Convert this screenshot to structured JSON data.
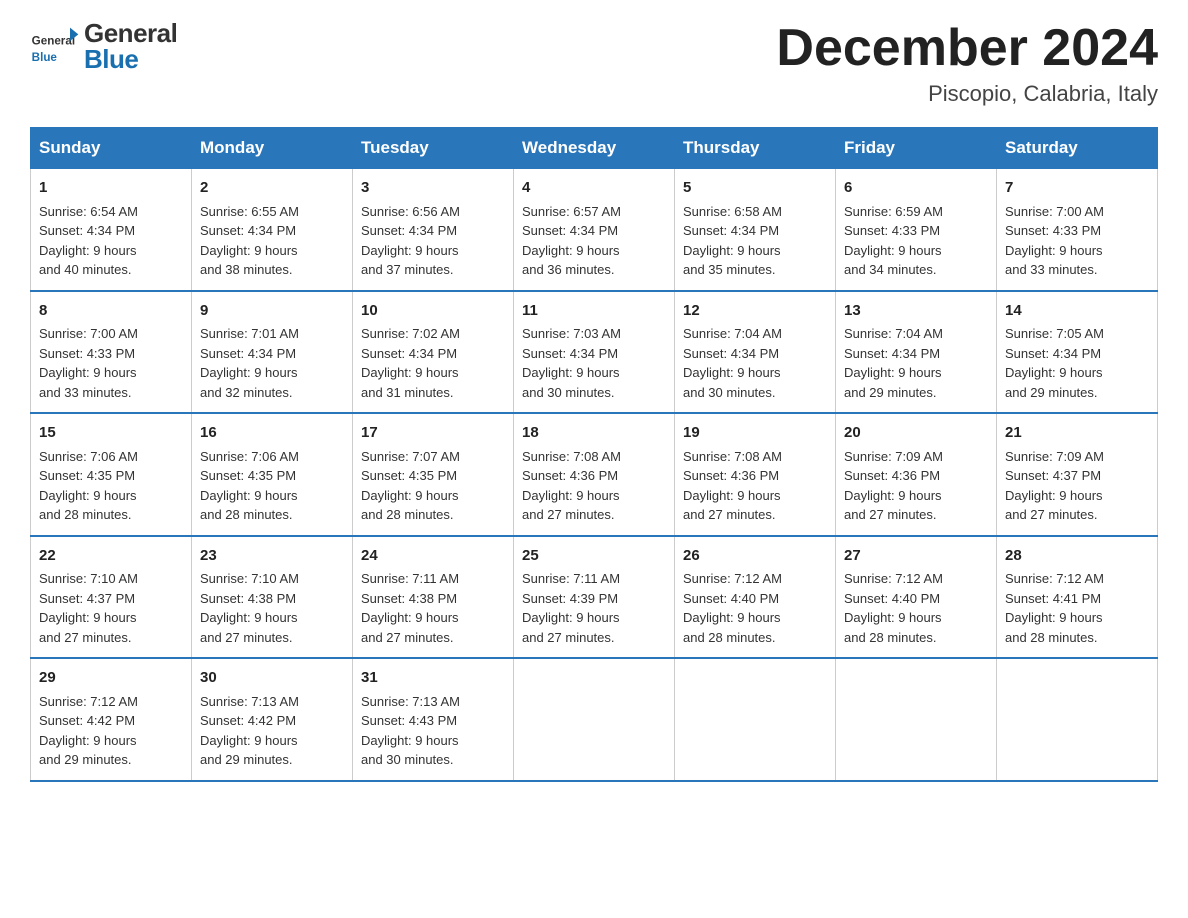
{
  "header": {
    "logo_general": "General",
    "logo_blue": "Blue",
    "title": "December 2024",
    "subtitle": "Piscopio, Calabria, Italy"
  },
  "days_of_week": [
    "Sunday",
    "Monday",
    "Tuesday",
    "Wednesday",
    "Thursday",
    "Friday",
    "Saturday"
  ],
  "weeks": [
    [
      {
        "day": "1",
        "sunrise": "6:54 AM",
        "sunset": "4:34 PM",
        "daylight": "9 hours and 40 minutes."
      },
      {
        "day": "2",
        "sunrise": "6:55 AM",
        "sunset": "4:34 PM",
        "daylight": "9 hours and 38 minutes."
      },
      {
        "day": "3",
        "sunrise": "6:56 AM",
        "sunset": "4:34 PM",
        "daylight": "9 hours and 37 minutes."
      },
      {
        "day": "4",
        "sunrise": "6:57 AM",
        "sunset": "4:34 PM",
        "daylight": "9 hours and 36 minutes."
      },
      {
        "day": "5",
        "sunrise": "6:58 AM",
        "sunset": "4:34 PM",
        "daylight": "9 hours and 35 minutes."
      },
      {
        "day": "6",
        "sunrise": "6:59 AM",
        "sunset": "4:33 PM",
        "daylight": "9 hours and 34 minutes."
      },
      {
        "day": "7",
        "sunrise": "7:00 AM",
        "sunset": "4:33 PM",
        "daylight": "9 hours and 33 minutes."
      }
    ],
    [
      {
        "day": "8",
        "sunrise": "7:00 AM",
        "sunset": "4:33 PM",
        "daylight": "9 hours and 33 minutes."
      },
      {
        "day": "9",
        "sunrise": "7:01 AM",
        "sunset": "4:34 PM",
        "daylight": "9 hours and 32 minutes."
      },
      {
        "day": "10",
        "sunrise": "7:02 AM",
        "sunset": "4:34 PM",
        "daylight": "9 hours and 31 minutes."
      },
      {
        "day": "11",
        "sunrise": "7:03 AM",
        "sunset": "4:34 PM",
        "daylight": "9 hours and 30 minutes."
      },
      {
        "day": "12",
        "sunrise": "7:04 AM",
        "sunset": "4:34 PM",
        "daylight": "9 hours and 30 minutes."
      },
      {
        "day": "13",
        "sunrise": "7:04 AM",
        "sunset": "4:34 PM",
        "daylight": "9 hours and 29 minutes."
      },
      {
        "day": "14",
        "sunrise": "7:05 AM",
        "sunset": "4:34 PM",
        "daylight": "9 hours and 29 minutes."
      }
    ],
    [
      {
        "day": "15",
        "sunrise": "7:06 AM",
        "sunset": "4:35 PM",
        "daylight": "9 hours and 28 minutes."
      },
      {
        "day": "16",
        "sunrise": "7:06 AM",
        "sunset": "4:35 PM",
        "daylight": "9 hours and 28 minutes."
      },
      {
        "day": "17",
        "sunrise": "7:07 AM",
        "sunset": "4:35 PM",
        "daylight": "9 hours and 28 minutes."
      },
      {
        "day": "18",
        "sunrise": "7:08 AM",
        "sunset": "4:36 PM",
        "daylight": "9 hours and 27 minutes."
      },
      {
        "day": "19",
        "sunrise": "7:08 AM",
        "sunset": "4:36 PM",
        "daylight": "9 hours and 27 minutes."
      },
      {
        "day": "20",
        "sunrise": "7:09 AM",
        "sunset": "4:36 PM",
        "daylight": "9 hours and 27 minutes."
      },
      {
        "day": "21",
        "sunrise": "7:09 AM",
        "sunset": "4:37 PM",
        "daylight": "9 hours and 27 minutes."
      }
    ],
    [
      {
        "day": "22",
        "sunrise": "7:10 AM",
        "sunset": "4:37 PM",
        "daylight": "9 hours and 27 minutes."
      },
      {
        "day": "23",
        "sunrise": "7:10 AM",
        "sunset": "4:38 PM",
        "daylight": "9 hours and 27 minutes."
      },
      {
        "day": "24",
        "sunrise": "7:11 AM",
        "sunset": "4:38 PM",
        "daylight": "9 hours and 27 minutes."
      },
      {
        "day": "25",
        "sunrise": "7:11 AM",
        "sunset": "4:39 PM",
        "daylight": "9 hours and 27 minutes."
      },
      {
        "day": "26",
        "sunrise": "7:12 AM",
        "sunset": "4:40 PM",
        "daylight": "9 hours and 28 minutes."
      },
      {
        "day": "27",
        "sunrise": "7:12 AM",
        "sunset": "4:40 PM",
        "daylight": "9 hours and 28 minutes."
      },
      {
        "day": "28",
        "sunrise": "7:12 AM",
        "sunset": "4:41 PM",
        "daylight": "9 hours and 28 minutes."
      }
    ],
    [
      {
        "day": "29",
        "sunrise": "7:12 AM",
        "sunset": "4:42 PM",
        "daylight": "9 hours and 29 minutes."
      },
      {
        "day": "30",
        "sunrise": "7:13 AM",
        "sunset": "4:42 PM",
        "daylight": "9 hours and 29 minutes."
      },
      {
        "day": "31",
        "sunrise": "7:13 AM",
        "sunset": "4:43 PM",
        "daylight": "9 hours and 30 minutes."
      },
      null,
      null,
      null,
      null
    ]
  ],
  "labels": {
    "sunrise": "Sunrise:",
    "sunset": "Sunset:",
    "daylight": "Daylight:"
  }
}
